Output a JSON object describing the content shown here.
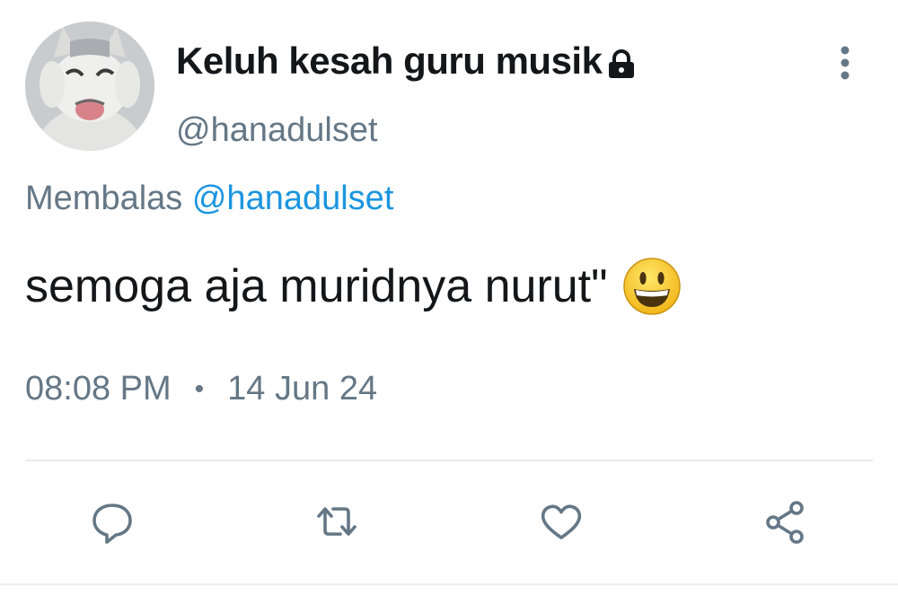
{
  "tweet": {
    "display_name": "Keluh kesah guru musik",
    "handle": "@hanadulset",
    "reply_prefix": "Membalas",
    "reply_to": "@hanadulset",
    "text": "semoga aja muridnya nurut\"",
    "time": "08:08 PM",
    "separator": "•",
    "date": "14 Jun 24"
  },
  "icons": {
    "lock": "lock-icon",
    "more": "more-vertical-icon",
    "emoji": "smiley-emoji",
    "reply": "reply-icon",
    "retweet": "retweet-icon",
    "like": "heart-icon",
    "share": "share-icon"
  },
  "colors": {
    "text_primary": "#14171a",
    "text_secondary": "#657786",
    "link": "#1b95e0",
    "divider": "#e6ecf0"
  }
}
